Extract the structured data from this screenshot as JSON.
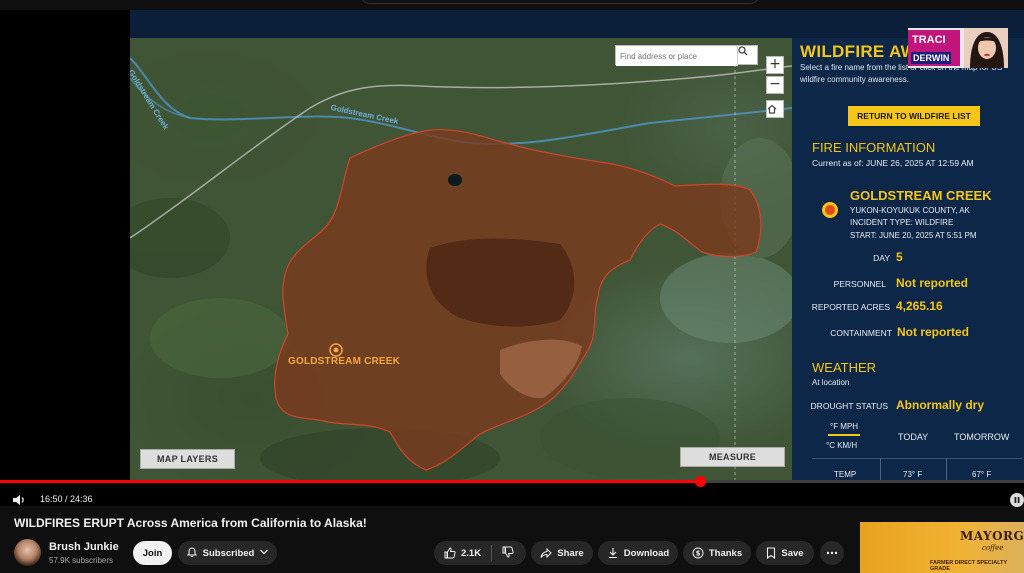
{
  "video": {
    "title": "WILDFIRES ERUPT Across America from California to Alaska!",
    "time_current": "16:50",
    "time_total": "24:36",
    "time_display": "16:50 / 24:36",
    "progress_fraction": 0.684
  },
  "channel": {
    "name": "Brush Junkie",
    "subscribers": "57.9K subscribers"
  },
  "actions": {
    "join": "Join",
    "subscribed": "Subscribed",
    "likes": "2.1K",
    "share": "Share",
    "download": "Download",
    "thanks": "Thanks",
    "save": "Save"
  },
  "overlay": {
    "line1": "TRACI",
    "line2": "DERWIN"
  },
  "map": {
    "search_placeholder": "Find address or place",
    "zoom_in": "+",
    "zoom_out": "−",
    "fire_label": "GOLDSTREAM CREEK",
    "creek_label_1": "Goldstream Creek",
    "creek_label_2": "Goldstream Creek",
    "map_layers_button": "MAP LAYERS",
    "measure_button": "MEASURE"
  },
  "panel": {
    "title": "WILDFIRE AW",
    "subtitle": "Select a fire name from the list or click on the map for US wildfire community awareness.",
    "return_button": "RETURN TO WILDFIRE LIST",
    "fire_info_head": "FIRE INFORMATION",
    "current_as_of": "Current as of: JUNE 26, 2025 AT 12:59 AM",
    "fire_name": "GOLDSTREAM CREEK",
    "county": "YUKON-KOYUKUK COUNTY, AK",
    "incident_type": "INCIDENT TYPE: WILDFIRE",
    "start": "START: JUNE 20, 2025 AT 5:51 PM",
    "day_label": "DAY",
    "day_value": "5",
    "personnel_label": "PERSONNEL",
    "personnel_value": "Not reported",
    "acres_label": "REPORTED ACRES",
    "acres_value": "4,265.16",
    "containment_label": "CONTAINMENT",
    "containment_value": "Not reported",
    "weather_head": "WEATHER",
    "at_location": "At location",
    "drought_label": "DROUGHT STATUS",
    "drought_value": "Abnormally dry",
    "unit_f": "°F MPH",
    "unit_c": "°C KM/H",
    "col_today": "TODAY",
    "col_tomorrow": "TOMORROW",
    "temp_label": "TEMP",
    "temp_today": "73° F",
    "temp_tomorrow": "67° F"
  },
  "ad": {
    "brand": "MAYORGA",
    "sub": "coffee",
    "tag": "FARMER DIRECT SPECIALTY GRADE"
  },
  "colors": {
    "accent_yellow": "#f5c518",
    "panel_navy": "#0d2748",
    "progress_red": "#ff0000",
    "fire_fill": "#7a3a1e"
  }
}
